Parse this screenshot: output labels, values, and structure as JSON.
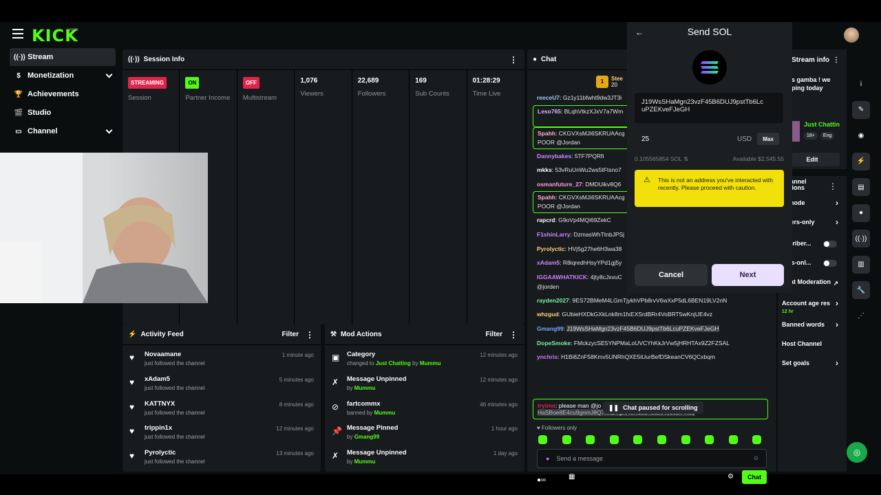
{
  "app": {
    "logo": "KICK",
    "beta": "BETA"
  },
  "sidebar": {
    "items": [
      {
        "label": "Stream",
        "icon": "broadcast-icon"
      },
      {
        "label": "Monetization",
        "icon": "dollar-icon"
      },
      {
        "label": "Achievements",
        "icon": "trophy-icon"
      },
      {
        "label": "Studio",
        "icon": "film-icon"
      },
      {
        "label": "Channel",
        "icon": "tv-icon"
      }
    ]
  },
  "session": {
    "title": "Session Info",
    "stats": [
      {
        "tag": "STREAMING",
        "label": "Session"
      },
      {
        "tag": "ON",
        "label": "Partner Income"
      },
      {
        "tag": "OFF",
        "label": "Multistream"
      },
      {
        "value": "1,076",
        "label": "Viewers"
      },
      {
        "value": "22,689",
        "label": "Followers"
      },
      {
        "value": "169",
        "label": "Sub Counts"
      },
      {
        "value": "01:28:29",
        "label": "Time Live"
      }
    ]
  },
  "activity": {
    "title": "Activity Feed",
    "filter": "Filter",
    "rows": [
      {
        "name": "Novaamane",
        "sub": "just followed the channel",
        "time": "1 minute ago"
      },
      {
        "name": "xAdam5",
        "sub": "just followed the channel",
        "time": "5 minutes ago"
      },
      {
        "name": "KATTNYX",
        "sub": "just followed the channel",
        "time": "8 minutes ago"
      },
      {
        "name": "trippin1x",
        "sub": "just followed the channel",
        "time": "12 minutes ago"
      },
      {
        "name": "Pyrolyctic",
        "sub": "just followed the channel",
        "time": "13 minutes ago"
      }
    ]
  },
  "mod": {
    "title": "Mod Actions",
    "filter": "Filter",
    "rows": [
      {
        "title": "Category",
        "pre": "changed to",
        "hl": "Just Chatting",
        "mid": "by",
        "by": "Mummu",
        "time": "12 minutes ago"
      },
      {
        "title": "Message Unpinned",
        "pre": "",
        "hl": "",
        "mid": "by",
        "by": "Mummu",
        "time": "12 minutes ago"
      },
      {
        "title": "fartcommx",
        "pre": "",
        "hl": "",
        "mid": "banned by",
        "by": "Mummu",
        "time": "46 minutes ago"
      },
      {
        "title": "Message Pinned",
        "pre": "",
        "hl": "",
        "mid": "by",
        "by": "Gmang99",
        "time": "1 hour ago"
      },
      {
        "title": "Message Unpinned",
        "pre": "",
        "hl": "",
        "mid": "by",
        "by": "Mummu",
        "time": "1 day ago"
      }
    ]
  },
  "chat": {
    "title": "Chat",
    "pinned": "Stee",
    "pinned_count": "20",
    "lines": [
      {
        "user": "reeceU7",
        "msg": "Gz1y11bfwht9dw3JT3i",
        "color": "#9ec8ff",
        "box": false
      },
      {
        "user": "Leso765",
        "msg": "BLqhVtkzXJxV7a7Wm",
        "color": "#d7b8ff",
        "box": true
      },
      {
        "user": "Spahh",
        "msg": "CKGVXsMJi6SKRUAAcg",
        "msg2": "POOR @Jordan",
        "color": "#ffb0d8",
        "box": true
      },
      {
        "user": "Dannybakes",
        "msg": "5TF7PQRfi",
        "color": "#c88bff",
        "box": false
      },
      {
        "user": "mkks",
        "msg": "53vRuUnWu2ws5tFtsno7",
        "color": "#ffffff",
        "box": false
      },
      {
        "user": "osmanfuture_27",
        "msg": "DMDUikv8Q6",
        "color": "#ff9ee0",
        "box": false
      },
      {
        "user": "Spahh",
        "msg": "CKGVXsMJi6SKRUAAcg",
        "msg2": "POOR @Jordan",
        "color": "#ffb0d8",
        "box": true
      },
      {
        "user": "rapcrd",
        "msg": "G9oVp4MQi69ZekC",
        "color": "#ffffff",
        "box": false
      },
      {
        "user": "F1shinLarry",
        "msg": "DzmasWhTtnbJPSj",
        "color": "#c88bff",
        "box": false
      },
      {
        "user": "Pyrolyctic",
        "msg": "HVj5g27he6H3wa38",
        "color": "#ffd27a",
        "box": false
      },
      {
        "user": "xAdam5",
        "msg": "R8iqredhHsyYPd1gj5y",
        "color": "#c88bff",
        "box": false
      },
      {
        "user": "IGGAAWHATKICK",
        "msg": "4jty8cJxvuC",
        "msg2": "@jorden",
        "color": "#d07cff",
        "box": false
      },
      {
        "user": "rayden2027",
        "msg": "9ES72BMeM4LGmTjykhVPb8rvV6wXxP5dL6BEN19LV2nN",
        "color": "#7af0a8",
        "box": false
      },
      {
        "user": "whzgud",
        "msg": "GUbieHXDkGXkLnk8m1fxEXSrdBRr4VoBRT5wKnjUE4vz",
        "color": "#ffd27a",
        "box": false
      },
      {
        "user": "Gmang99",
        "msg": "J19WsSHaMgn23vzF45B6DUJ9pstTb6LcuPZEKveFJeGH",
        "color": "#7aa8ff",
        "box": false,
        "hl": true
      },
      {
        "user": "DopeSmoke",
        "msg": "FMckzycSE5YNPMaLoUVCYhKkJrVw5jHRHTAx9Z2FZSAL",
        "color": "#7af0a8",
        "box": false
      },
      {
        "user": "ynchris",
        "msg": "H1Bi8ZnF58Kmv5UNRhQXE5iUurBefDSkeanCV6QCxbqm",
        "color": "#d07cff",
        "box": false
      }
    ],
    "last_user": "tryimo",
    "last_msg": "please man @jo",
    "last_msg2": "HaSBoe8E4cu9gnmJ8Q7nK2YgKH8H19L4u3z6Tob6DPKuq",
    "paused": "Chat paused for scrolling",
    "followers_only": "Followers only",
    "placeholder": "Send a message",
    "send": "Chat"
  },
  "modal": {
    "title": "Send SOL",
    "address": "J19WsSHaMgn23vzF45B6DUJ9pstTb6LcuPZEKveFJeGH",
    "amount": "25",
    "currency": "USD",
    "max": "Max",
    "sol_equiv": "0.105565854 SOL",
    "available": "Available $2,545.55",
    "warning": "This is not an address you've interacted with recently. Please proceed with caution.",
    "cancel": "Cancel",
    "next": "Next"
  },
  "stream_info": {
    "title": "Stream info",
    "text": "s gamba ! we",
    "text2": "ping today",
    "cat": "Just Chattin",
    "badge1": "18+",
    "badge2": "Eng",
    "edit": "Edit"
  },
  "channel_actions": {
    "title": "Channel Actions",
    "items": [
      {
        "label": "w mode",
        "kind": "chev"
      },
      {
        "label": "owers-only",
        "sub": "n",
        "kind": "chev"
      },
      {
        "label": "bscriber...",
        "kind": "tog"
      },
      {
        "label": "otes-onl...",
        "kind": "tog"
      },
      {
        "label": "Chat Moderation",
        "kind": "ext"
      },
      {
        "label": "Account age res",
        "sub": "12 hr",
        "kind": "chev"
      },
      {
        "label": "Banned words",
        "kind": "chev"
      },
      {
        "label": "Host Channel",
        "kind": "none"
      },
      {
        "label": "Set goals",
        "kind": "chev"
      }
    ]
  },
  "colors": {
    "accent": "#53fc18",
    "streaming": "#e0254a",
    "warning": "#f2e00a"
  }
}
